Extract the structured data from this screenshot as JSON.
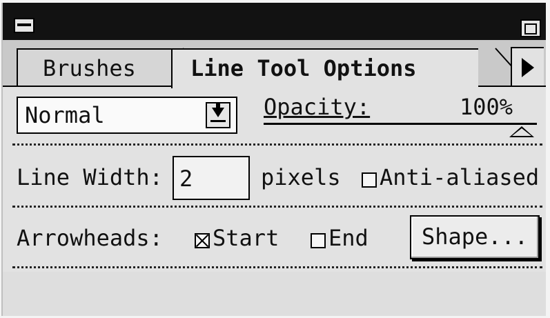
{
  "palette": {
    "tabs": [
      {
        "label": "Brushes",
        "active": false
      },
      {
        "label": "Line Tool Options",
        "active": true
      }
    ]
  },
  "blend_mode": {
    "selected": "Normal"
  },
  "opacity": {
    "label": "Opacity:",
    "value_text": "100%",
    "value": 1.0
  },
  "line_width": {
    "label": "Line Width:",
    "value": "2",
    "unit": "pixels"
  },
  "anti_aliased": {
    "label": "Anti-aliased",
    "checked": false
  },
  "arrowheads": {
    "label": "Arrowheads:",
    "start_label": "Start",
    "start_checked": true,
    "end_label": "End",
    "end_checked": false,
    "shape_button": "Shape..."
  },
  "colors": {
    "titlebar": "#121212",
    "panel": "#e2e2e2"
  },
  "icons": [
    "collapse-icon",
    "zoom-icon",
    "palette-menu-arrow-icon",
    "dropdown-arrow-icon"
  ]
}
